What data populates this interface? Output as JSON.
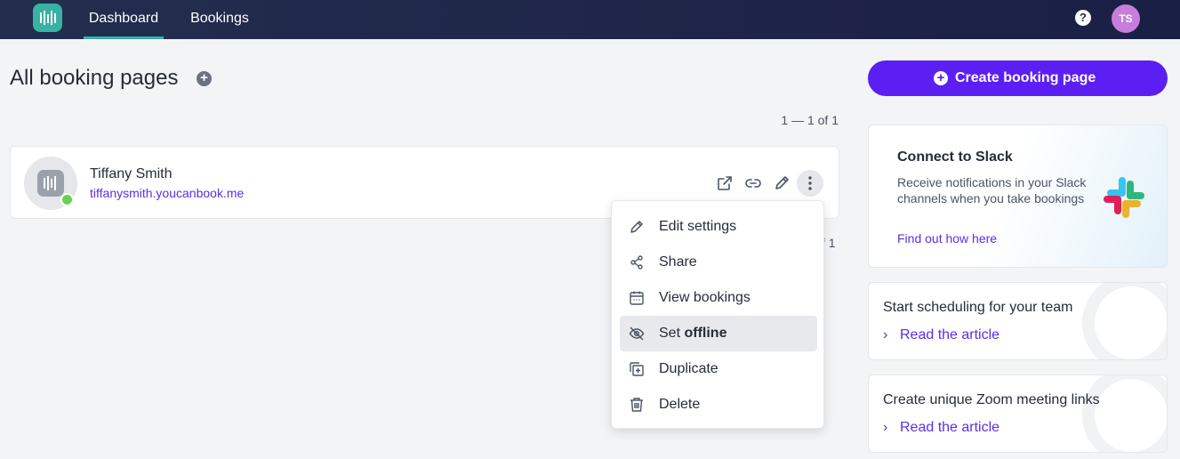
{
  "nav": {
    "tabs": [
      {
        "label": "Dashboard"
      },
      {
        "label": "Bookings"
      }
    ],
    "help_icon": "question-icon",
    "user_initials": "TS"
  },
  "main": {
    "title": "All booking pages",
    "pagination_top": "1 — 1 of 1",
    "pagination_bottom_visible": "f 1",
    "booking_page": {
      "name": "Tiffany Smith",
      "url": "tiffanysmith.youcanbook.me",
      "status": "online"
    },
    "menu": {
      "items": [
        {
          "label": "Edit settings",
          "icon": "pencil-icon"
        },
        {
          "label": "Share",
          "icon": "share-icon"
        },
        {
          "label": "View bookings",
          "icon": "calendar-icon"
        },
        {
          "label_prefix": "Set ",
          "label_bold": "offline",
          "icon": "eye-off-icon",
          "active": true
        },
        {
          "label": "Duplicate",
          "icon": "duplicate-icon"
        },
        {
          "label": "Delete",
          "icon": "trash-icon"
        }
      ]
    }
  },
  "sidebar": {
    "create_button": "Create booking page",
    "slack": {
      "title": "Connect to Slack",
      "description": "Receive notifications in your Slack channels when you take bookings",
      "link": "Find out how here"
    },
    "articles": [
      {
        "title": "Start scheduling for your team",
        "link": "Read the article"
      },
      {
        "title": "Create unique Zoom meeting links",
        "link": "Read the article"
      }
    ]
  },
  "colors": {
    "nav_bg": "#1f2548",
    "accent_teal": "#37b2a3",
    "primary_purple": "#5b1ff3",
    "link_purple": "#5b2ee6",
    "status_green": "#6ad04e"
  }
}
